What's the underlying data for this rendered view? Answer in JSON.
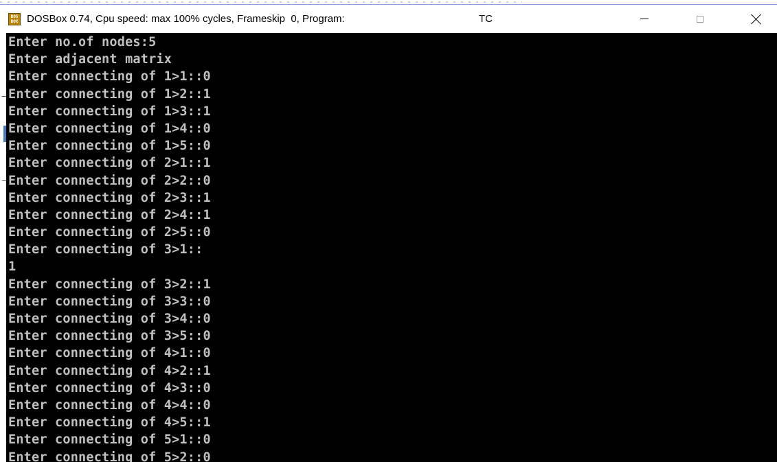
{
  "window": {
    "title": "DOSBox 0.74, Cpu speed: max 100% cycles, Frameskip  0, Program:",
    "program": "TC",
    "app_icon_text": [
      "DOS",
      "BOX"
    ],
    "controls": {
      "minimize": "minimize-icon",
      "maximize": "maximize-icon",
      "close": "close-icon"
    }
  },
  "console": {
    "colors": {
      "background": "#000000",
      "text": "#c0c0c0"
    },
    "lines": [
      "Enter no.of nodes:5",
      "Enter adjacent matrix",
      "Enter connecting of 1>1::0",
      "Enter connecting of 1>2::1",
      "Enter connecting of 1>3::1",
      "Enter connecting of 1>4::0",
      "Enter connecting of 1>5::0",
      "Enter connecting of 2>1::1",
      "Enter connecting of 2>2::0",
      "Enter connecting of 2>3::1",
      "Enter connecting of 2>4::1",
      "Enter connecting of 2>5::0",
      "Enter connecting of 3>1::",
      "1",
      "Enter connecting of 3>2::1",
      "Enter connecting of 3>3::0",
      "Enter connecting of 3>4::0",
      "Enter connecting of 3>5::0",
      "Enter connecting of 4>1::0",
      "Enter connecting of 4>2::1",
      "Enter connecting of 4>3::0",
      "Enter connecting of 4>4::0",
      "Enter connecting of 4>5::1",
      "Enter connecting of 5>1::0",
      "Enter connecting of 5>2::0"
    ]
  }
}
